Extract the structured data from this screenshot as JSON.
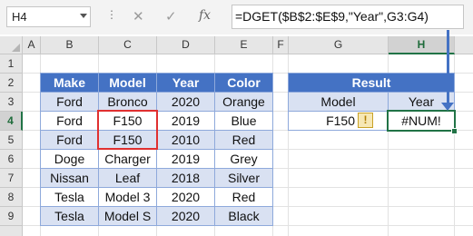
{
  "formula_bar": {
    "name_box": "H4",
    "formula": "=DGET($B$2:$E$9,\"Year\",G3:G4)",
    "cancel_icon": "close-icon",
    "enter_icon": "check-icon",
    "fx_label": "fx"
  },
  "columns": [
    "A",
    "B",
    "C",
    "D",
    "E",
    "F",
    "G",
    "H"
  ],
  "rows": [
    "1",
    "2",
    "3",
    "4",
    "5",
    "6",
    "7",
    "8",
    "9"
  ],
  "selected": {
    "column": "H",
    "row": "4"
  },
  "main_table": {
    "headers": [
      "Make",
      "Model",
      "Year",
      "Color"
    ],
    "rows": [
      [
        "Ford",
        "Bronco",
        "2020",
        "Orange"
      ],
      [
        "Ford",
        "F150",
        "2019",
        "Blue"
      ],
      [
        "Ford",
        "F150",
        "2010",
        "Red"
      ],
      [
        "Doge",
        "Charger",
        "2019",
        "Grey"
      ],
      [
        "Nissan",
        "Leaf",
        "2018",
        "Silver"
      ],
      [
        "Tesla",
        "Model 3",
        "2020",
        "Red"
      ],
      [
        "Tesla",
        "Model S",
        "2020",
        "Black"
      ]
    ]
  },
  "result_table": {
    "title": "Result",
    "headers": [
      "Model",
      "Year"
    ],
    "criteria_value": "F150",
    "result_value": "#NUM!"
  },
  "colors": {
    "header_blue": "#4472c4",
    "band_blue": "#d9e1f2",
    "highlight_red": "#e03030",
    "selection_green": "#217346",
    "arrow_blue": "#4472c4"
  }
}
